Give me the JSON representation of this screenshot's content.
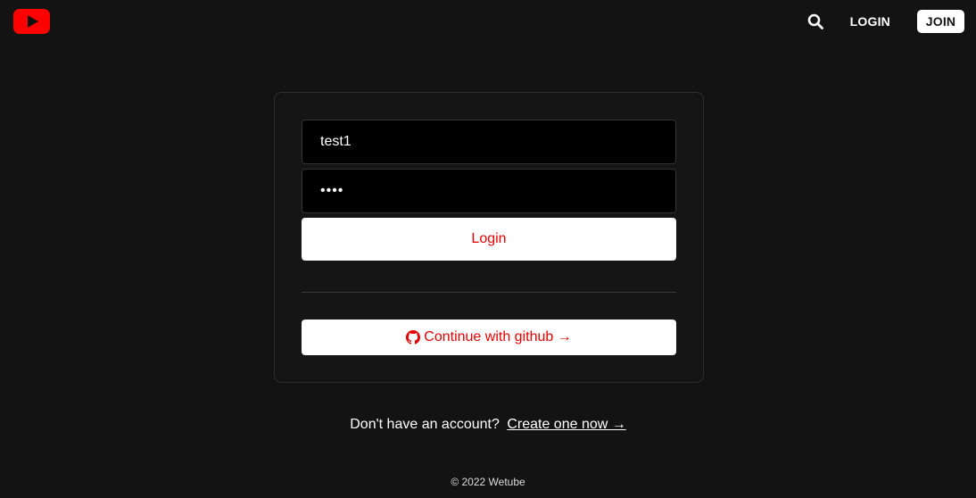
{
  "header": {
    "logo_icon": "play-icon",
    "nav": {
      "search_icon": "search-icon",
      "login_label": "LOGIN",
      "join_label": "JOIN"
    }
  },
  "form": {
    "username_value": "test1",
    "password_value": "1234",
    "login_button": "Login",
    "github_button": "Continue with github →",
    "github_icon": "github-icon"
  },
  "signup": {
    "prompt": "Don't have an account?",
    "link": "Create one now →"
  },
  "footer": {
    "copyright": "© 2022 Wetube"
  },
  "colors": {
    "background": "#131313",
    "brand_red": "#ff0000",
    "button_text": "#e60000"
  }
}
